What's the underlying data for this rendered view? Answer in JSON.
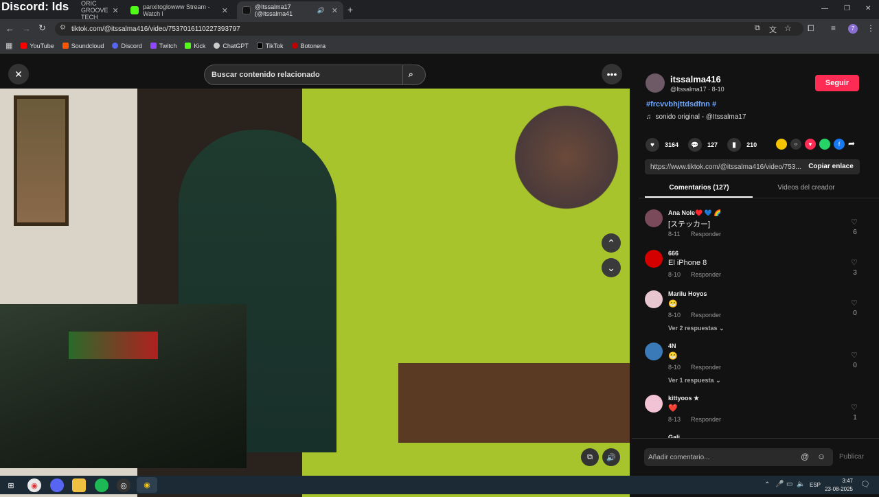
{
  "overlay_text": "Discord: lds",
  "tabs": [
    {
      "label": "ORIC GROOVE TECH",
      "active": false
    },
    {
      "label": "panxitoglowww Stream - Watch l",
      "active": false
    },
    {
      "label": "@Itssalma17 (@itssalma41",
      "active": true
    }
  ],
  "new_tab": "+",
  "window_controls": {
    "minimize": "—",
    "restore": "❐",
    "close": "✕"
  },
  "address": "tiktok.com/@itssalma416/video/7537016110227393797",
  "bookmarks": [
    {
      "label": "YouTube",
      "color": "#ff0000"
    },
    {
      "label": "Soundcloud",
      "color": "#ff5500"
    },
    {
      "label": "Discord",
      "color": "#5865f2"
    },
    {
      "label": "Twitch",
      "color": "#9146ff"
    },
    {
      "label": "Kick",
      "color": "#53fc18"
    },
    {
      "label": "ChatGPT",
      "color": "#cccccc"
    },
    {
      "label": "TikTok",
      "color": "#000000"
    },
    {
      "label": "Botonera",
      "color": "#c00000"
    }
  ],
  "search_placeholder": "Buscar contenido relacionado",
  "creator": {
    "username": "itssalma416",
    "handle_date": "@Itssalma17 · 8-10",
    "follow": "Seguir",
    "hashtags": "#frcvvbhjttdsdfnn #",
    "sound": "sonido original - @Itssalma17"
  },
  "stats": {
    "likes": "3164",
    "comments": "127",
    "saves": "210"
  },
  "share": {
    "url": "https://www.tiktok.com/@itssalma416/video/753...",
    "copy": "Copiar enlace"
  },
  "side_tabs": {
    "comments": "Comentarios (127)",
    "videos": "Videos del creador"
  },
  "reply_label": "Responder",
  "comments": [
    {
      "name": "Ana Nole♥️ 💙 🌈",
      "text": "[ステッカー]",
      "date": "8-11",
      "likes": "6",
      "avatar_color": "#7a4a5a"
    },
    {
      "name": "666",
      "text": "El iPhone 8",
      "date": "8-10",
      "likes": "3",
      "avatar_color": "#d40000"
    },
    {
      "name": "Marilu Hoyos",
      "text": "😁",
      "date": "8-10",
      "likes": "0",
      "avatar_color": "#e8c6d0"
    },
    {
      "name": "4N",
      "text": "😁",
      "date": "8-10",
      "likes": "0",
      "avatar_color": "#3a7ab8"
    },
    {
      "name": "kittyoos ★",
      "text": "❤️",
      "date": "8-13",
      "likes": "1",
      "avatar_color": "#f2c3d4"
    }
  ],
  "more_replies": [
    "Ver 2 respuestas",
    "Ver 1 respuesta"
  ],
  "partial_name": "Gali",
  "add_comment": "Añadir comentario...",
  "publish": "Publicar",
  "tray": {
    "lang": "ESP",
    "time": "3:47",
    "date": "23-08-2025"
  }
}
